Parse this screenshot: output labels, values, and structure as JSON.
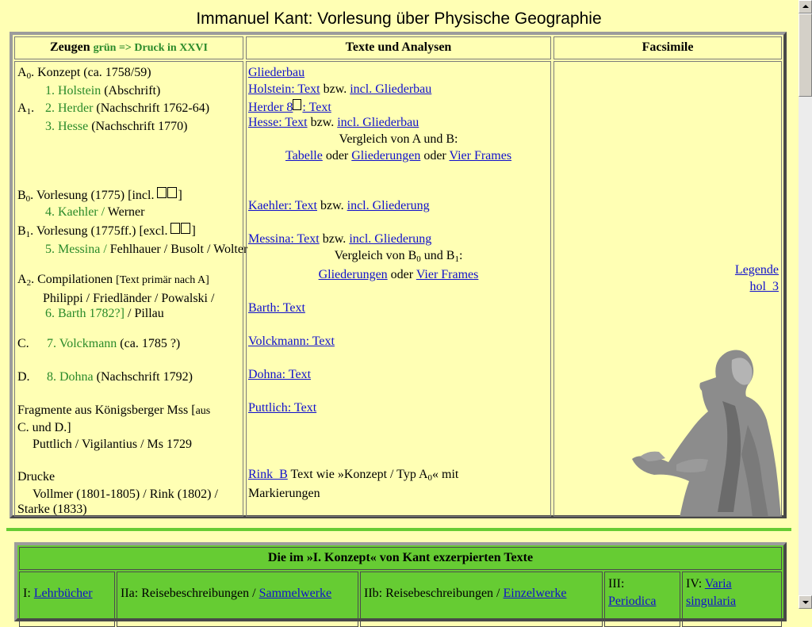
{
  "page": {
    "title": "Immanuel Kant: Vorlesung über Physische Geographie"
  },
  "headers": {
    "zeugen_main": "Zeugen",
    "zeugen_note": "grün => Druck in XXVI",
    "texte": "Texte und Analysen",
    "facsimile": "Facsimile"
  },
  "zeugen": {
    "a0_pre": "A",
    "a0_sub": "0",
    "a0_text": ". Konzept (ca. 1758/59)",
    "holstein_num": "1. Holstein",
    "holstein_rest": " (Abschrift)",
    "a1_pre": "A",
    "a1_sub": "1",
    "a1_dot": ".",
    "herder_num": "2. Herder",
    "herder_rest": " (Nachschrift 1762-64)",
    "hesse_num": "3. Hesse",
    "hesse_rest": " (Nachschrift 1770)",
    "b0_pre": "B",
    "b0_sub": "0",
    "b0_text": ". Vorlesung (1775) [incl.",
    "b0_close": "]",
    "kaehler_num": "4. Kaehler",
    "kaehler_slash": " / ",
    "kaehler_rest": "Werner",
    "b1_pre": "B",
    "b1_sub": "1",
    "b1_text": ". Vorlesung (1775ff.) [excl.",
    "b1_close": "]",
    "messina_num": "5. Messina",
    "messina_slash": " / ",
    "messina_rest": "Fehlhauer / Busolt / Wolter",
    "a2_pre": "A",
    "a2_sub": "2",
    "a2_text": ". Compilationen ",
    "a2_note": "[Text primär nach A]",
    "philippi_line": "Philippi / Friedländer / Powalski /",
    "barth_num": "6. Barth 1782?]",
    "barth_slash": " / ",
    "barth_rest": "Pillau",
    "c_label": "C.",
    "volckmann_num": "7. Volckmann",
    "volckmann_rest": " (ca. 1785 ?)",
    "d_label": "D.",
    "dohna_num": "8. Dohna",
    "dohna_rest": " (Nachschrift 1792)",
    "fragmente_a": "Fragmente aus Königsberger Mss [",
    "fragmente_b": "aus",
    "fragmente_c": "C. und D.",
    "fragmente_d": "]",
    "puttlich_line": "Puttlich / Vigilantius / Ms 1729",
    "drucke": "Drucke",
    "vollmer_line": "Vollmer (1801-1805) / Rink (1802) /",
    "starke_line": "Starke (1833)"
  },
  "texte": {
    "gliederbau": "Gliederbau",
    "holstein_text": "Holstein: Text",
    "bzw": " bzw. ",
    "incl_gliederbau": "incl. Gliederbau",
    "herder_text_a": "Herder 8",
    "herder_text_b": ": Text",
    "hesse_text": "Hesse: Text",
    "hesse_bzw": " bzw. ",
    "hesse_incl": "incl. Gliederbau",
    "vergleich_ab": "Vergleich von A und B:",
    "tabelle": "Tabelle",
    "oder1": " oder ",
    "gliederungen1": "Gliederungen",
    "oder2": " oder ",
    "vier_frames1": "Vier Frames",
    "kaehler_text": "Kaehler: Text",
    "kaehler_bzw": " bzw. ",
    "kaehler_incl": "incl. Gliederung",
    "messina_text": "Messina: Text",
    "messina_bzw": " bzw. ",
    "messina_incl": "incl. Gliederung",
    "vergleich_b_pre": "Vergleich von B",
    "vergleich_b_sub0": "0",
    "vergleich_b_mid": " und B",
    "vergleich_b_sub1": "1",
    "vergleich_b_end": ":",
    "gliederungen2": "Gliederungen",
    "oder3": " oder ",
    "vier_frames2": "Vier Frames",
    "barth_text": "Barth: Text",
    "volckmann_text": "Volckmann: Text",
    "dohna_text": "Dohna: Text",
    "puttlich_text": "Puttlich: Text",
    "rink_b": "Rink_B",
    "rink_rest": " Text wie »Konzept / Typ A",
    "rink_sub": "0",
    "rink_end": "« mit",
    "markierungen": "Markierungen"
  },
  "facsimile": {
    "legende": "Legende",
    "hol3": "hol_3"
  },
  "bottom": {
    "title": "Die im »I. Konzept« von Kant exzerpierten Texte",
    "c1_label": "I: ",
    "c1_link": "Lehrbücher",
    "c2_label": "IIa: Reisebeschreibungen / ",
    "c2_link": "Sammelwerke",
    "c3_label": "IIb: Reisebeschreibungen / ",
    "c3_link": "Einzelwerke",
    "c4_label": "III:",
    "c4_link": "Periodica",
    "c5_label": "IV: ",
    "c5_link_a": "Varia",
    "c5_link_b": "singularia"
  },
  "colors": {
    "page_bg": "#FFFFB4",
    "green_text": "#2A8A2A",
    "green_band": "#66CC33",
    "link": "#1010CC"
  }
}
